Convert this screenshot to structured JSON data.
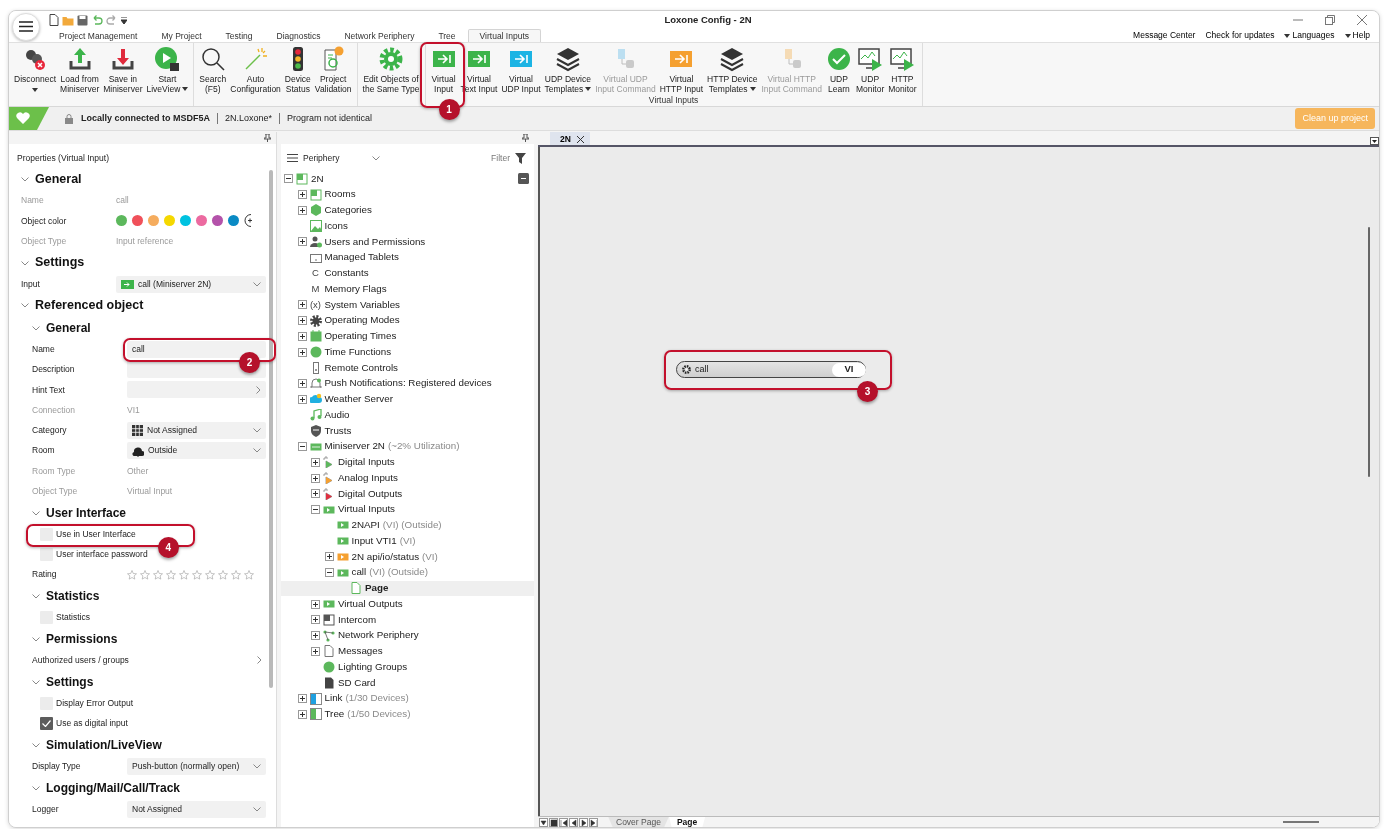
{
  "window": {
    "title": "Loxone Config - 2N"
  },
  "menu_tabs": [
    {
      "label": "Project Management",
      "selected": false
    },
    {
      "label": "My Project",
      "selected": false
    },
    {
      "label": "Testing",
      "selected": false
    },
    {
      "label": "Diagnostics",
      "selected": false
    },
    {
      "label": "Network Periphery",
      "selected": false
    },
    {
      "label": "Tree",
      "selected": false
    },
    {
      "label": "Virtual Inputs",
      "selected": true
    }
  ],
  "top_links": [
    {
      "label": "Message Center",
      "dropdown": false
    },
    {
      "label": "Check for updates",
      "dropdown": false
    },
    {
      "label": "Languages",
      "dropdown": true
    },
    {
      "label": "Help",
      "dropdown": true
    }
  ],
  "ribbon_groups": [
    {
      "buttons": [
        {
          "label": "Disconnect",
          "kind": "disconnect",
          "dropdown": true
        },
        {
          "label": "Load from\nMiniserver",
          "kind": "upload"
        },
        {
          "label": "Save in\nMiniserver",
          "kind": "download"
        },
        {
          "label": "Start\nLiveView",
          "kind": "liveview",
          "dropdown": true
        }
      ]
    },
    {
      "buttons": [
        {
          "label": "Search\n(F5)",
          "kind": "search"
        },
        {
          "label": "Auto\nConfiguration",
          "kind": "wand"
        },
        {
          "label": "Device\nStatus",
          "kind": "traffic"
        },
        {
          "label": "Project\nValidation",
          "kind": "validation"
        }
      ]
    },
    {
      "buttons": [
        {
          "label": "Edit Objects of\nthe Same Type",
          "kind": "gear"
        }
      ]
    },
    {
      "caption": "Virtual Inputs",
      "buttons": [
        {
          "label": "Virtual\nInput",
          "kind": "input",
          "callout": "1"
        },
        {
          "label": "Virtual\nText Input",
          "kind": "input"
        },
        {
          "label": "Virtual\nUDP Input",
          "kind": "udpinput"
        },
        {
          "label": "UDP Device\nTemplates",
          "kind": "layers",
          "dropdown": true
        },
        {
          "label": "Virtual UDP\nInput Command",
          "kind": "udpcommand",
          "disabled": true
        },
        {
          "label": "Virtual\nHTTP Input",
          "kind": "httpinput"
        },
        {
          "label": "HTTP Device\nTemplates",
          "kind": "layers",
          "dropdown": true
        },
        {
          "label": "Virtual HTTP\nInput Command",
          "kind": "httpcommand",
          "disabled": true
        },
        {
          "label": "UDP\nLearn",
          "kind": "check"
        },
        {
          "label": "UDP\nMonitor",
          "kind": "monitor"
        },
        {
          "label": "HTTP\nMonitor",
          "kind": "monitor"
        }
      ]
    }
  ],
  "status": {
    "connection": "Locally connected to MSDF5A",
    "project": "2N.Loxone*",
    "state": "Program not identical",
    "cleanup_button": "Clean up project"
  },
  "properties": {
    "title": "Properties (Virtual Input)",
    "sections": [
      {
        "title": "General",
        "expanded": true,
        "rows": [
          {
            "kind": "text",
            "label": "Name",
            "value": "call",
            "disabled": true
          },
          {
            "kind": "colors",
            "label": "Object color",
            "swatches": [
              {
                "color": "#5cb85c"
              },
              {
                "color": "#f0505a"
              },
              {
                "color": "#f5ac5e"
              },
              {
                "color": "#f5d800"
              },
              {
                "color": "#00c2e0"
              },
              {
                "color": "#ec6aa0"
              },
              {
                "color": "#b452aa"
              },
              {
                "color": "#0a8ac4"
              }
            ]
          },
          {
            "kind": "text",
            "label": "Object Type",
            "value": "Input reference",
            "disabled": true
          }
        ]
      },
      {
        "title": "Settings",
        "expanded": true,
        "rows": [
          {
            "kind": "select",
            "label": "Input",
            "value": "call (Miniserver 2N)"
          }
        ]
      },
      {
        "title": "Referenced object",
        "expanded": true,
        "sections": [
          {
            "title": "General",
            "expanded": true,
            "rows": [
              {
                "kind": "input",
                "label": "Name",
                "value": "call",
                "callout": "2"
              },
              {
                "kind": "input",
                "label": "Description"
              },
              {
                "kind": "picker",
                "label": "Hint Text"
              },
              {
                "kind": "text",
                "label": "Connection",
                "value": "VI1",
                "disabled": true
              },
              {
                "kind": "select",
                "label": "Category",
                "value": "Not Assigned"
              },
              {
                "kind": "select",
                "label": "Room",
                "value": "Outside"
              },
              {
                "kind": "text",
                "label": "Room Type",
                "value": "Other",
                "disabled": true
              },
              {
                "kind": "text",
                "label": "Object Type",
                "value": "Virtual Input",
                "disabled": true
              }
            ]
          },
          {
            "title": "User Interface",
            "expanded": true,
            "rows": [
              {
                "kind": "checkbox",
                "label": "Use in User Interface",
                "checked": false,
                "callout": "4"
              },
              {
                "kind": "checkbox",
                "label": "User interface password",
                "checked": false
              },
              {
                "kind": "stars",
                "label": "Rating",
                "stars": 0
              }
            ]
          },
          {
            "title": "Statistics",
            "expanded": true,
            "rows": [
              {
                "kind": "checkbox",
                "label": "Statistics",
                "checked": false
              }
            ]
          },
          {
            "title": "Permissions",
            "expanded": true,
            "rows": [
              {
                "kind": "link",
                "label": "Authorized users / groups"
              }
            ]
          },
          {
            "title": "Settings",
            "expanded": true,
            "rows": [
              {
                "kind": "checkbox",
                "label": "Display Error Output",
                "checked": false
              },
              {
                "kind": "checkbox",
                "label": "Use as digital input",
                "checked": true
              }
            ]
          },
          {
            "title": "Simulation/LiveView",
            "expanded": true,
            "rows": [
              {
                "kind": "select",
                "label": "Display Type",
                "value": "Push-button (normally open)"
              }
            ]
          },
          {
            "title": "Logging/Mail/Call/Track",
            "expanded": true,
            "rows": [
              {
                "kind": "select",
                "label": "Logger",
                "value": "Not Assigned"
              }
            ]
          }
        ]
      }
    ]
  },
  "periphery": {
    "view": "Periphery",
    "filter": "Filter",
    "tree": [
      {
        "label": "2N",
        "kind": "project",
        "expanded": true,
        "selected": false,
        "children": [
          {
            "label": "Rooms",
            "kind": "rooms",
            "expanded": false,
            "selected": false
          },
          {
            "label": "Categories",
            "kind": "category",
            "expanded": false,
            "selected": false
          },
          {
            "label": "Icons",
            "kind": "image",
            "selected": false
          },
          {
            "label": "Users and Permissions",
            "kind": "users",
            "expanded": false,
            "selected": false
          },
          {
            "label": "Managed Tablets",
            "kind": "tablet",
            "selected": false
          },
          {
            "label": "Constants",
            "glyph": "C",
            "selected": false
          },
          {
            "label": "Memory Flags",
            "glyph": "M",
            "selected": false
          },
          {
            "label": "System Variables",
            "glyph": "(x)",
            "expanded": false,
            "selected": false
          },
          {
            "label": "Operating Modes",
            "kind": "gear",
            "expanded": false,
            "selected": false
          },
          {
            "label": "Operating Times",
            "kind": "calendar",
            "expanded": false,
            "selected": false
          },
          {
            "label": "Time Functions",
            "kind": "clock",
            "expanded": false,
            "selected": false
          },
          {
            "label": "Remote Controls",
            "kind": "remote",
            "selected": false
          },
          {
            "label": "Push Notifications: Registered devices",
            "kind": "bell",
            "expanded": false,
            "selected": false
          },
          {
            "label": "Weather Server",
            "kind": "weather",
            "expanded": false,
            "selected": false
          },
          {
            "label": "Audio",
            "kind": "music",
            "selected": false
          },
          {
            "label": "Trusts",
            "kind": "shield",
            "selected": false
          },
          {
            "label": "Miniserver 2N",
            "detail": "(~2% Utilization)",
            "kind": "module",
            "expanded": true,
            "selected": false,
            "children": [
              {
                "label": "Digital Inputs",
                "kind": "digitalin",
                "expanded": false,
                "selected": false
              },
              {
                "label": "Analog Inputs",
                "kind": "analogin",
                "expanded": false,
                "selected": false
              },
              {
                "label": "Digital Outputs",
                "kind": "digitalout",
                "expanded": false,
                "selected": false
              },
              {
                "label": "Virtual Inputs",
                "kind": "input",
                "expanded": true,
                "selected": false,
                "children": [
                  {
                    "label": "2NAPI",
                    "detail": "(VI) (Outside)",
                    "kind": "input",
                    "selected": false
                  },
                  {
                    "label": "Input VTI1",
                    "detail": "(VI)",
                    "kind": "input",
                    "selected": false
                  },
                  {
                    "label": "2N api/io/status",
                    "detail": "(VI)",
                    "kind": "httpinput",
                    "expanded": false,
                    "selected": false
                  },
                  {
                    "label": "call",
                    "detail": "(VI) (Outside)",
                    "kind": "input",
                    "expanded": true,
                    "selected": false,
                    "children": [
                      {
                        "label": "Page",
                        "kind": "page",
                        "selected": true
                      }
                    ]
                  }
                ]
              },
              {
                "label": "Virtual Outputs",
                "kind": "input",
                "expanded": false,
                "selected": false
              },
              {
                "label": "Intercom",
                "kind": "intercom",
                "expanded": false,
                "selected": false
              },
              {
                "label": "Network Periphery",
                "kind": "network",
                "expanded": false,
                "selected": false
              },
              {
                "label": "Messages",
                "kind": "document",
                "expanded": false,
                "selected": false
              },
              {
                "label": "Lighting Groups",
                "kind": "light",
                "selected": false
              },
              {
                "label": "SD Card",
                "kind": "sdcard",
                "selected": false
              }
            ]
          },
          {
            "label": "Link",
            "detail": "(1/30 Devices)",
            "kind": "link",
            "expanded": false,
            "selected": false
          },
          {
            "label": "Tree",
            "detail": "(1/50 Devices)",
            "kind": "tree",
            "expanded": false,
            "selected": false
          }
        ]
      }
    ]
  },
  "canvas": {
    "tab": "2N",
    "node": {
      "label": "call",
      "tag": "VI",
      "callout": "3"
    },
    "pages": [
      {
        "label": "Cover Page",
        "selected": false
      },
      {
        "label": "Page",
        "selected": true
      }
    ]
  }
}
